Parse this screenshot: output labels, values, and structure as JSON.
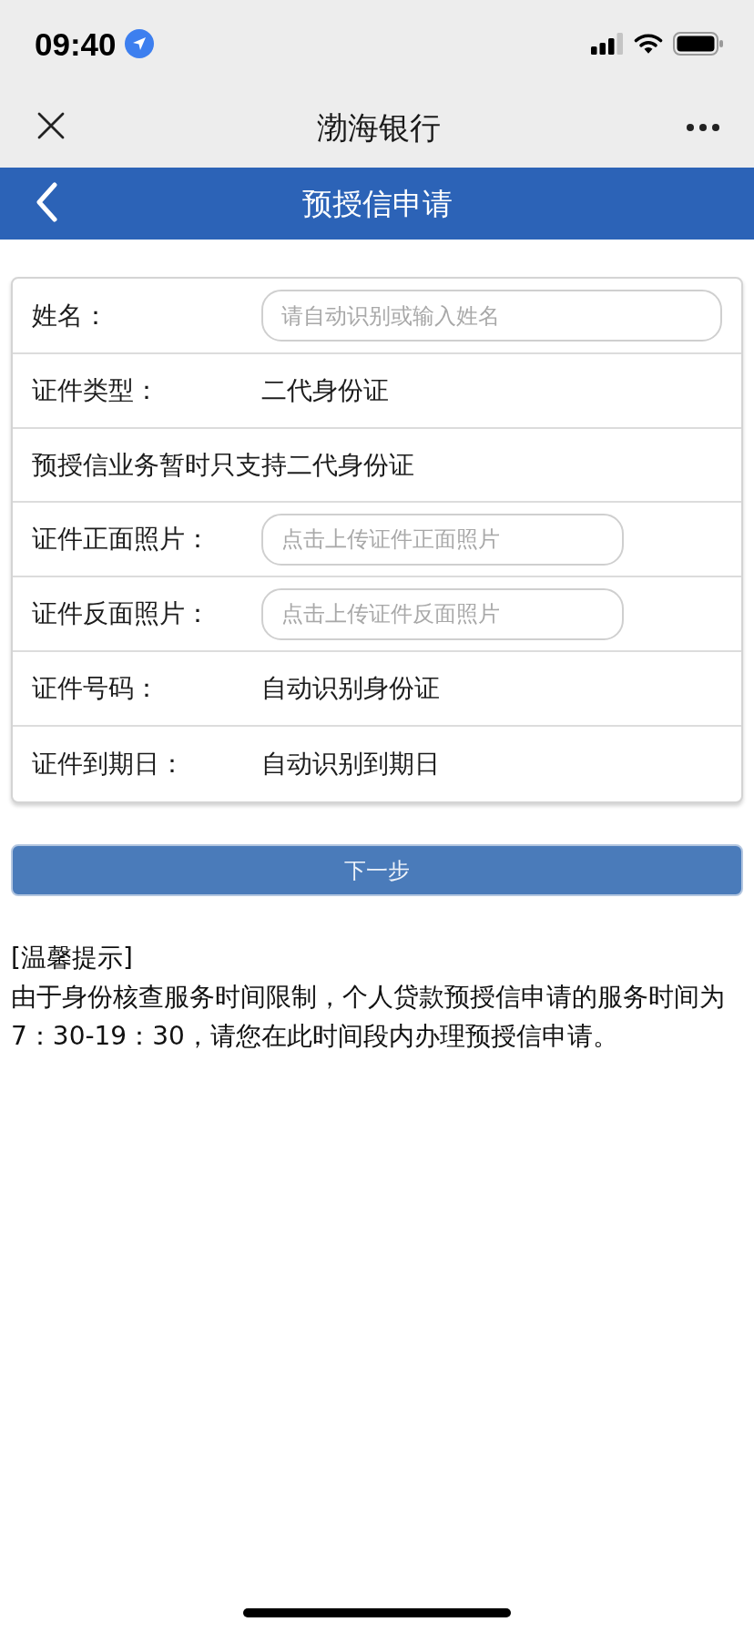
{
  "status_bar": {
    "time": "09:40"
  },
  "nav_bar": {
    "title": "渤海银行"
  },
  "header": {
    "title": "预授信申请"
  },
  "form": {
    "rows": [
      {
        "kind": "input",
        "label": "姓名：",
        "placeholder": "请自动识别或输入姓名"
      },
      {
        "kind": "text",
        "label": "证件类型：",
        "value": "二代身份证"
      },
      {
        "kind": "note",
        "text": "预授信业务暂时只支持二代身份证"
      },
      {
        "kind": "upload",
        "label": "证件正面照片：",
        "placeholder": "点击上传证件正面照片"
      },
      {
        "kind": "upload",
        "label": "证件反面照片：",
        "placeholder": "点击上传证件反面照片"
      },
      {
        "kind": "text",
        "label": "证件号码：",
        "value": "自动识别身份证"
      },
      {
        "kind": "text",
        "label": "证件到期日：",
        "value": "自动识别到期日"
      }
    ]
  },
  "next_button": {
    "label": "下一步"
  },
  "tips": {
    "heading": "[温馨提示]",
    "text": "由于身份核查服务时间限制，个人贷款预授信申请的服务时间为7：30-19：30，请您在此时间段内办理预授信申请。"
  }
}
